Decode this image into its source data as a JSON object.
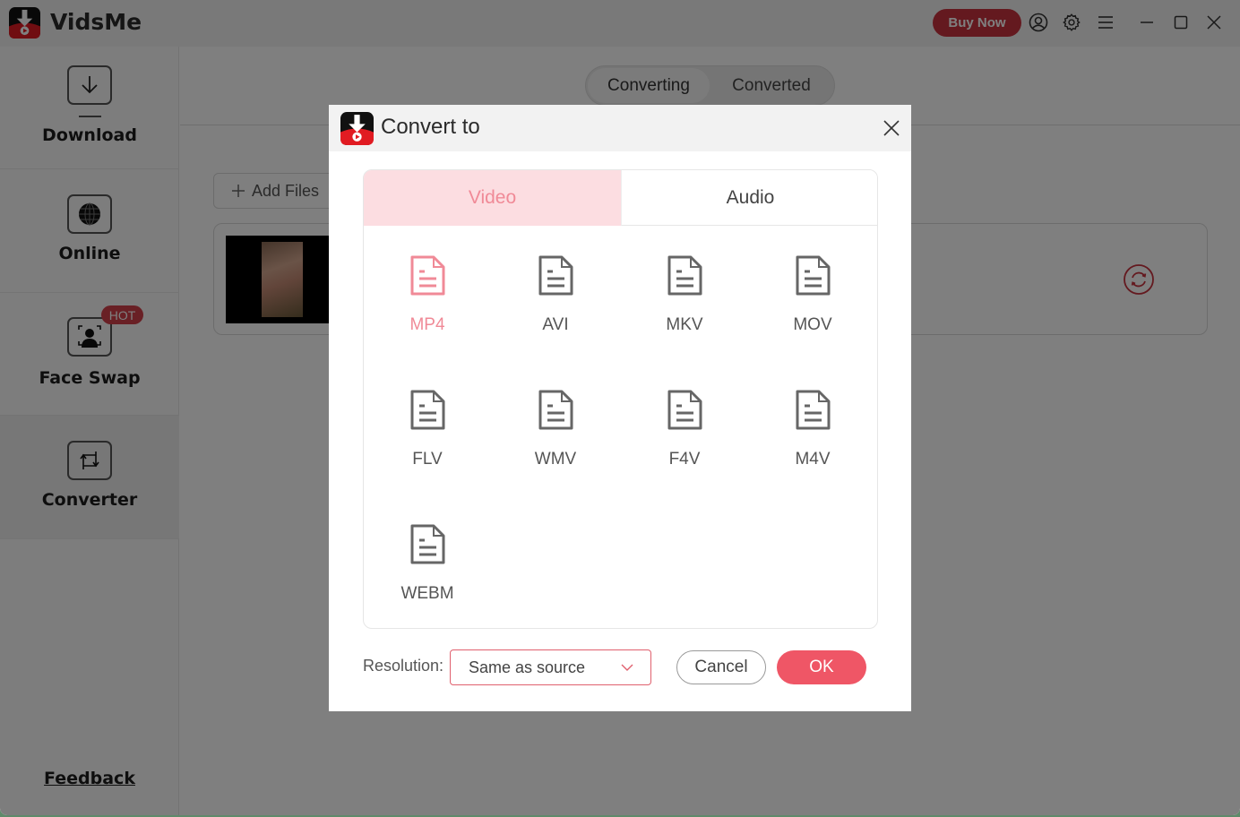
{
  "app": {
    "name": "VidsMe",
    "buy_now_label": "Buy Now",
    "titlebar_icons": [
      "account-icon",
      "settings-icon",
      "menu-icon",
      "minimize-icon",
      "maximize-icon",
      "close-icon"
    ]
  },
  "sidebar": {
    "items": [
      {
        "label": "Download",
        "icon": "download-icon",
        "active": false
      },
      {
        "label": "Online",
        "icon": "globe-icon",
        "active": false
      },
      {
        "label": "Face Swap",
        "icon": "face-scan-icon",
        "badge": "HOT",
        "active": false
      },
      {
        "label": "Converter",
        "icon": "convert-icon",
        "active": true
      }
    ],
    "feedback_label": "Feedback"
  },
  "main": {
    "tabs": [
      {
        "label": "Converting",
        "active": true
      },
      {
        "label": "Converted",
        "active": false
      }
    ],
    "add_files_label": "Add Files"
  },
  "dialog": {
    "title": "Convert to",
    "tabs": [
      {
        "label": "Video",
        "active": true
      },
      {
        "label": "Audio",
        "active": false
      }
    ],
    "formats": [
      "MP4",
      "AVI",
      "MKV",
      "MOV",
      "FLV",
      "WMV",
      "F4V",
      "M4V",
      "WEBM"
    ],
    "selected_format": "MP4",
    "resolution_label": "Resolution:",
    "resolution_value": "Same as source",
    "cancel_label": "Cancel",
    "ok_label": "OK"
  },
  "colors": {
    "accent": "#ef5666",
    "accent_light": "#fcdde1",
    "accent_text": "#f08a97",
    "brand_red": "#c8323e"
  }
}
